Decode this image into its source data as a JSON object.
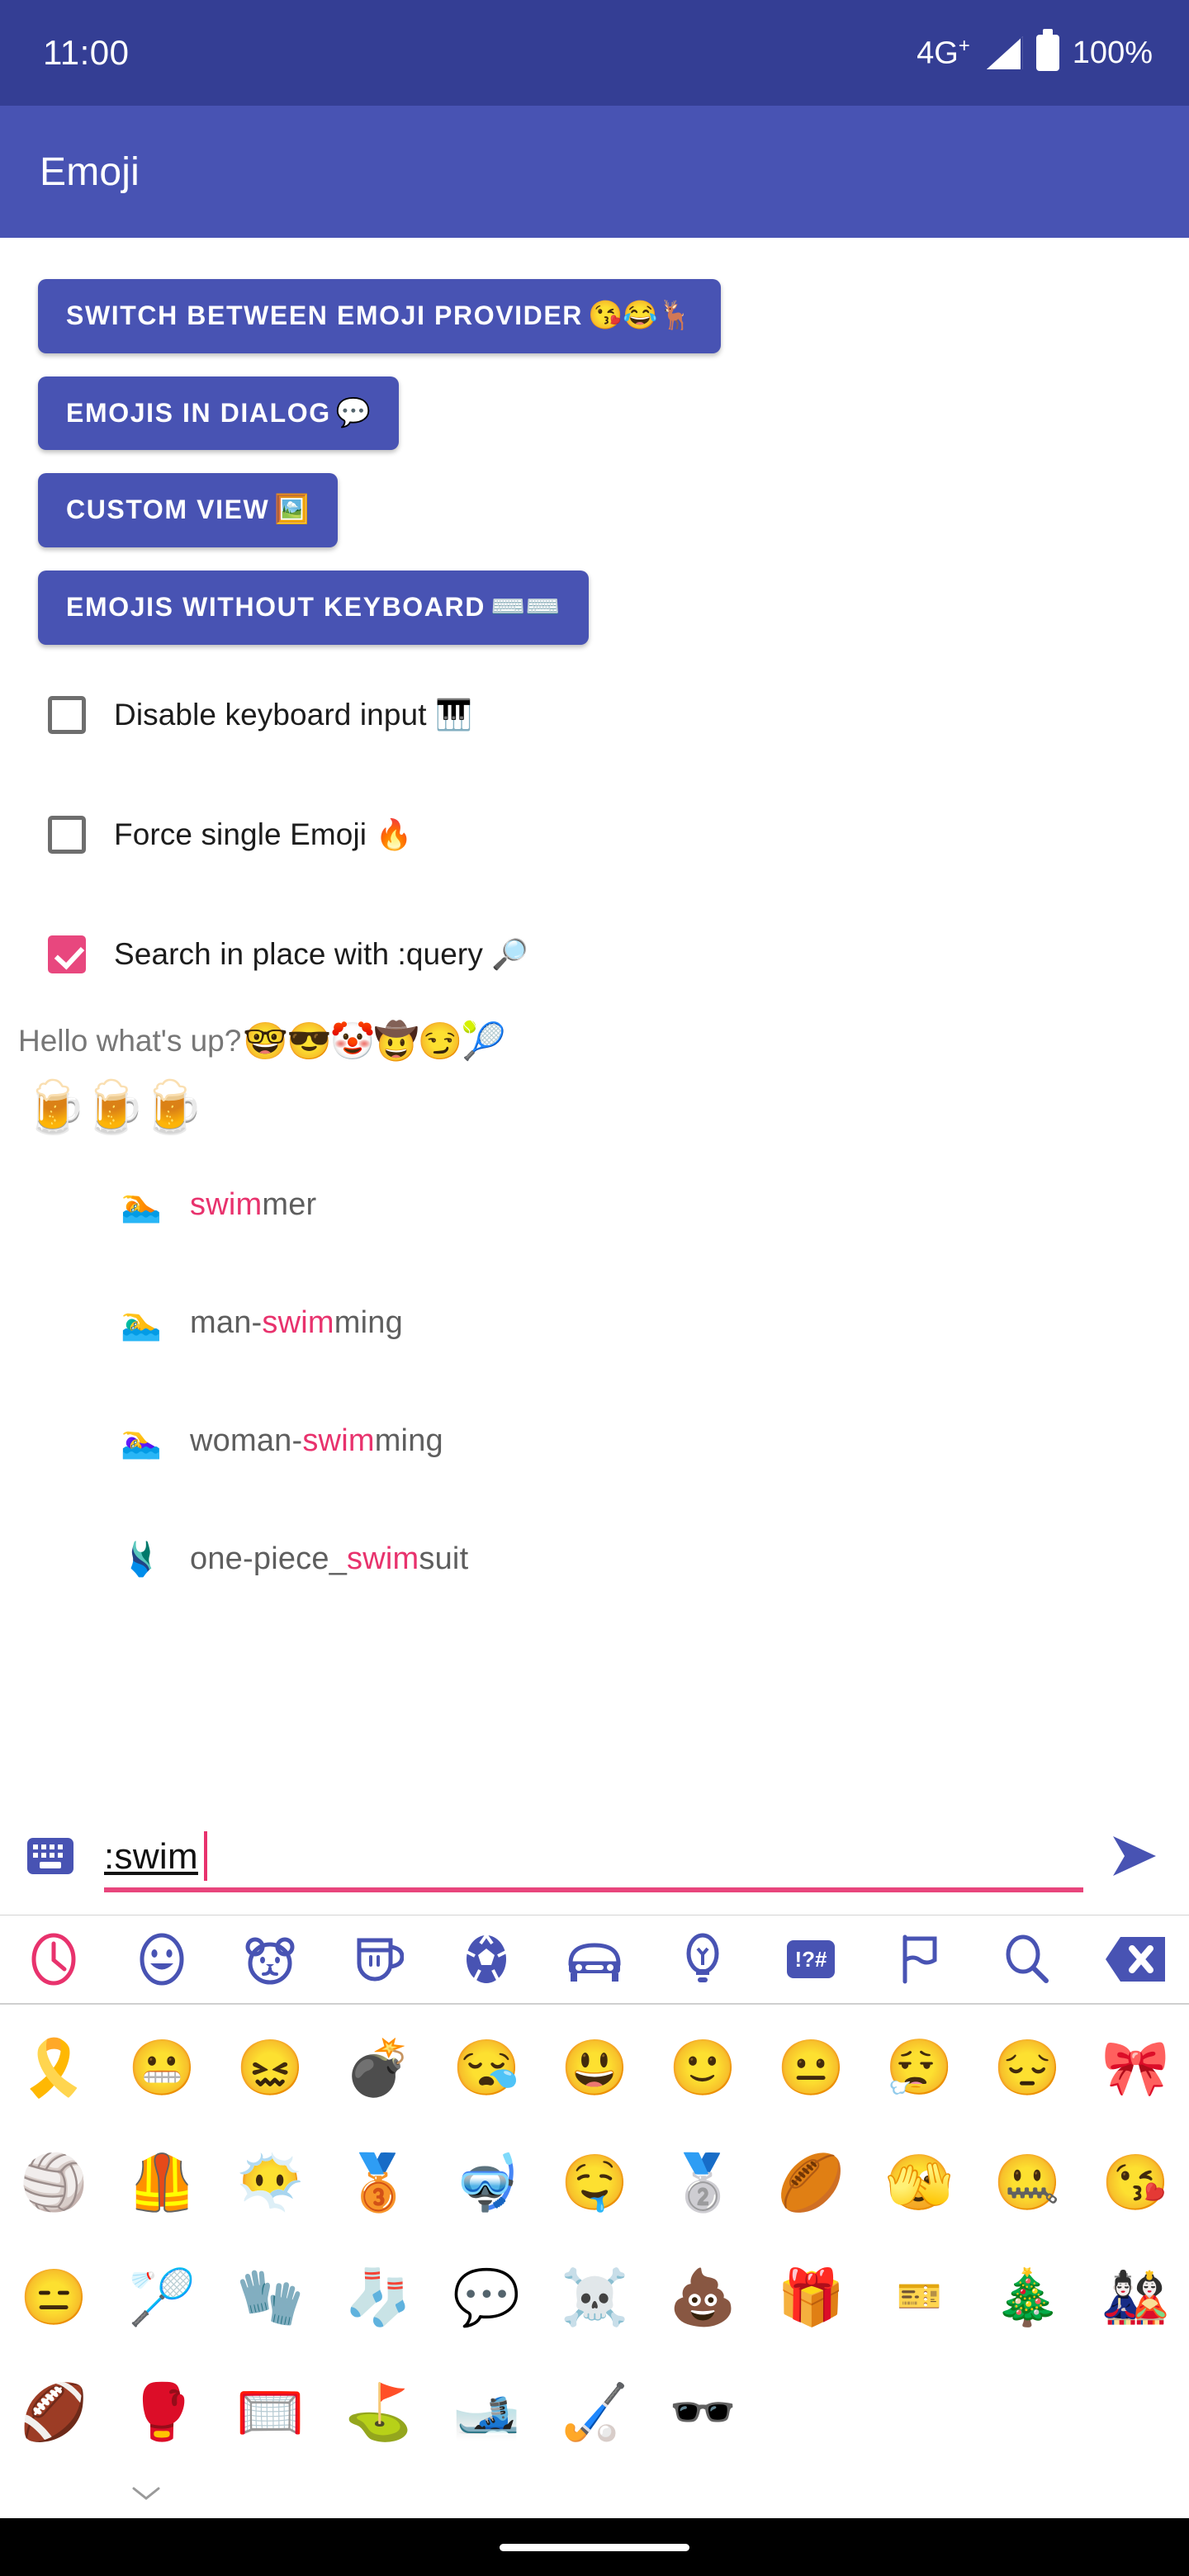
{
  "status_bar": {
    "clock": "11:00",
    "network": "4G",
    "network_sup": "+",
    "battery_percent": "100%",
    "icons": [
      "signal-icon",
      "battery-icon"
    ]
  },
  "app_bar": {
    "title": "Emoji"
  },
  "colors": {
    "status_bar_bg": "#343e94",
    "app_bar_bg": "#4853b3",
    "primary": "#4853b3",
    "accent_pink": "#e8326d",
    "checkbox_checked": "#e8477e",
    "text_gray": "#5e5e5e"
  },
  "buttons": [
    {
      "label": "SWITCH BETWEEN EMOJI PROVIDER",
      "emoji": "😘😂🦌",
      "name": "switch-emoji-provider-button"
    },
    {
      "label": "EMOJIS IN DIALOG",
      "emoji": "💬",
      "name": "emojis-in-dialog-button"
    },
    {
      "label": "CUSTOM VIEW",
      "emoji": "🖼️",
      "name": "custom-view-button"
    },
    {
      "label": "EMOJIS WITHOUT KEYBOARD",
      "emoji": "⌨️⌨️",
      "name": "emojis-without-keyboard-button"
    }
  ],
  "checkboxes": [
    {
      "label": "Disable keyboard input",
      "emoji": "🎹",
      "checked": false,
      "name": "disable-keyboard-input-checkbox"
    },
    {
      "label": "Force single Emoji",
      "emoji": "🔥",
      "checked": false,
      "name": "force-single-emoji-checkbox"
    },
    {
      "label": "Search in place with :query",
      "emoji": "🔎",
      "checked": true,
      "name": "search-in-place-checkbox"
    }
  ],
  "hello": {
    "text": "Hello what's up?",
    "emoji": "🤓😎🤡🤠😏🎾"
  },
  "beer_line": "🍺🍺🍺",
  "suggestions": [
    {
      "emoji": "🏊",
      "prefix": "",
      "match": "swim",
      "suffix": "mer"
    },
    {
      "emoji": "🏊‍♂️",
      "prefix": "man-",
      "match": "swim",
      "suffix": "ming"
    },
    {
      "emoji": "🏊‍♀️",
      "prefix": "woman-",
      "match": "swim",
      "suffix": "ming"
    },
    {
      "emoji": "🩱",
      "prefix": "one-piece_",
      "match": "swim",
      "suffix": "suit"
    }
  ],
  "input_bar": {
    "keyboard_icon": "keyboard-icon",
    "value": ":swim",
    "placeholder": "",
    "send_icon": "send-icon"
  },
  "categories": [
    {
      "name": "recent",
      "icon": "clock-icon",
      "selected": true
    },
    {
      "name": "smileys",
      "icon": "smiley-icon",
      "selected": false
    },
    {
      "name": "animals",
      "icon": "bear-icon",
      "selected": false
    },
    {
      "name": "food",
      "icon": "cup-icon",
      "selected": false
    },
    {
      "name": "activity",
      "icon": "soccer-ball-icon",
      "selected": false
    },
    {
      "name": "travel",
      "icon": "car-icon",
      "selected": false
    },
    {
      "name": "objects",
      "icon": "lightbulb-icon",
      "selected": false
    },
    {
      "name": "symbols",
      "icon": "symbols-icon",
      "selected": false
    },
    {
      "name": "flags",
      "icon": "flag-icon",
      "selected": false
    },
    {
      "name": "search",
      "icon": "search-icon",
      "selected": false
    },
    {
      "name": "backspace",
      "icon": "backspace-icon",
      "selected": false
    }
  ],
  "emoji_grid": [
    [
      "🎗️",
      "😬",
      "😖",
      "💣",
      "😪",
      "😃",
      "🙂",
      "😐",
      "😮‍💨",
      "😔",
      "🎀"
    ],
    [
      "🏐",
      "🦺",
      "😶‍🌫️",
      "🥉",
      "🤿",
      "🤤",
      "🥈",
      "🏉",
      "🫣",
      "🤐",
      "😘"
    ],
    [
      "😑",
      "🏸",
      "🧤",
      "🧦",
      "💬",
      "☠️",
      "💩",
      "🎁",
      "🎫",
      "🎄",
      "🎎"
    ],
    [
      "🏈",
      "🥊",
      "🥅",
      "⛳",
      "🎿",
      "🏑",
      "🕶️"
    ]
  ],
  "bottom": {
    "scroll_hint_icon": "chevron-down-icon",
    "nav_pill": "home-indicator"
  }
}
